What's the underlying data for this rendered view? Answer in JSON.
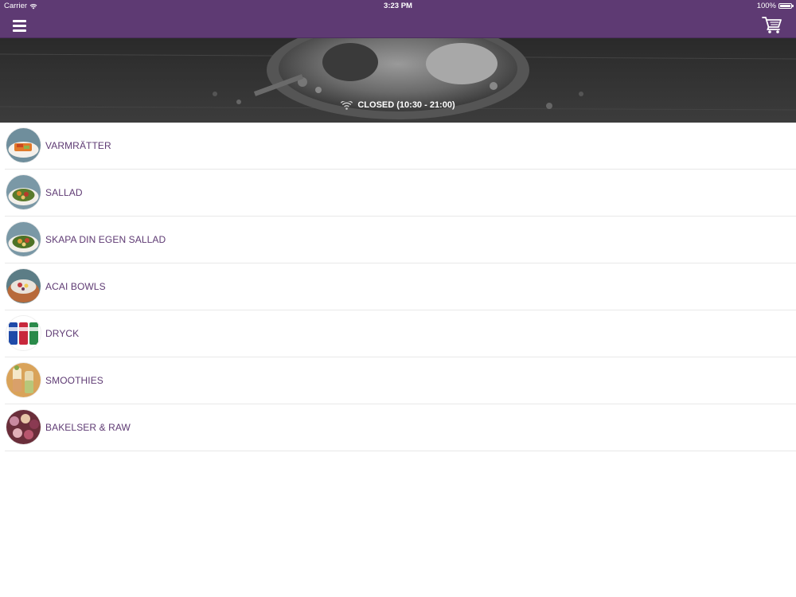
{
  "status_bar": {
    "carrier": "Carrier",
    "time": "3:23 PM",
    "battery": "100%",
    "battery_level": 1.0
  },
  "nav": {
    "menu_icon": "hamburger-menu-icon",
    "cart_icon": "shopping-cart-icon"
  },
  "hero": {
    "status_icon": "wifi-icon",
    "status_text": "CLOSED (10:30 - 21:00)"
  },
  "categories": [
    {
      "label": "VARMRÄTTER",
      "thumb": "warm-dish-thumbnail"
    },
    {
      "label": "SALLAD",
      "thumb": "salad-thumbnail"
    },
    {
      "label": "SKAPA DIN EGEN SALLAD",
      "thumb": "custom-salad-thumbnail"
    },
    {
      "label": "ACAI BOWLS",
      "thumb": "acai-bowl-thumbnail"
    },
    {
      "label": "DRYCK",
      "thumb": "drinks-thumbnail"
    },
    {
      "label": "SMOOTHIES",
      "thumb": "smoothies-thumbnail"
    },
    {
      "label": "BAKELSER & RAW",
      "thumb": "pastries-thumbnail"
    }
  ],
  "colors": {
    "brand": "#5e3a73",
    "background": "#ffffff",
    "divider": "#e8e8e8"
  }
}
